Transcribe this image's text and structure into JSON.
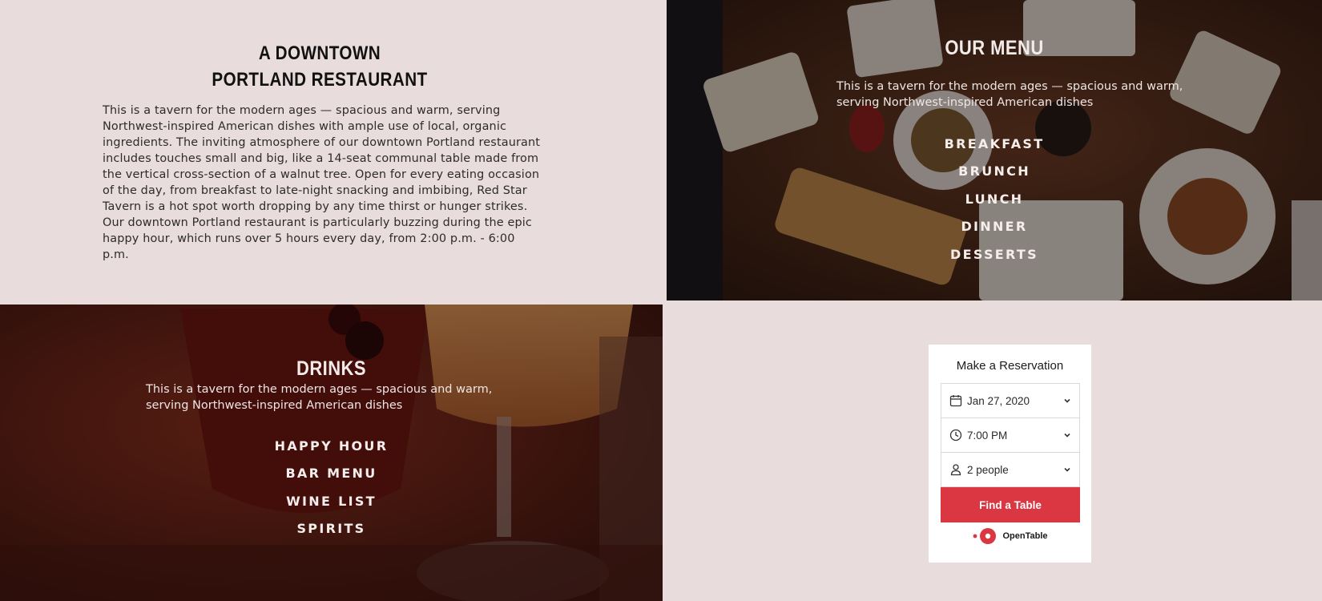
{
  "intro": {
    "heading_line1": "A DOWNTOWN",
    "heading_line2": "PORTLAND RESTAURANT",
    "body": "This is a tavern for the modern ages — spacious and warm, serving Northwest-inspired American dishes with ample use of local, organic ingredients. The inviting atmosphere of our downtown Portland restaurant includes touches small and big, like a 14-seat communal table made from the vertical cross-section of a walnut tree. Open for every eating occasion of the day, from breakfast to late-night snacking and imbibing, Red Star Tavern is a hot spot worth dropping by any time thirst or hunger strikes. Our downtown Portland restaurant is particularly buzzing during the epic happy hour, which runs over 5 hours every day, from 2:00 p.m. - 6:00 p.m."
  },
  "menu": {
    "title": "OUR MENU",
    "description": "This is a tavern for the modern ages — spacious and warm, serving Northwest-inspired American dishes",
    "links": [
      "BREAKFAST",
      "BRUNCH",
      "LUNCH",
      "DINNER",
      "DESSERTS"
    ]
  },
  "drinks": {
    "title": "DRINKS",
    "description": "This is a tavern for the modern ages — spacious and warm, serving Northwest-inspired American dishes",
    "links": [
      "HAPPY HOUR",
      "BAR MENU",
      "WINE LIST",
      "SPIRITS"
    ]
  },
  "reservation": {
    "title": "Make a Reservation",
    "date": "Jan 27, 2020",
    "time": "7:00 PM",
    "party": "2 people",
    "button": "Find a Table",
    "brand": "OpenTable"
  },
  "icons": {
    "date": "calendar-icon",
    "time": "clock-icon",
    "party": "person-icon",
    "dropdown": "chevron-down-icon",
    "brand": "opentable-logo-icon"
  },
  "colors": {
    "page_background": "#e9dcdd",
    "accent": "#da3743",
    "heading_text": "#111111"
  }
}
